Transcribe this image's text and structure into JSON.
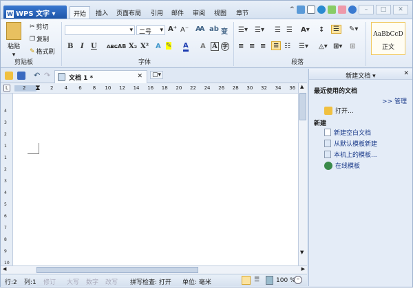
{
  "app": {
    "name": "WPS 文字"
  },
  "tabs": [
    "开始",
    "插入",
    "页面布局",
    "引用",
    "邮件",
    "审阅",
    "视图",
    "章节"
  ],
  "ribbon": {
    "clipboard": {
      "paste": "粘贴",
      "cut": "剪切",
      "copy": "复制",
      "format_painter": "格式刷",
      "label": "剪贴板"
    },
    "font": {
      "font_name": "",
      "font_size": "二号",
      "label": "字体",
      "bold": "B",
      "italic": "I",
      "underline": "U",
      "strike": "ABC",
      "double_strike": "AB",
      "subscript": "X₂",
      "superscript": "X²"
    },
    "paragraph": {
      "label": "段落"
    },
    "styles": {
      "preview": "AaBbCcD",
      "name": "正文"
    }
  },
  "document": {
    "tab_title": "文档 1 *"
  },
  "ruler": {
    "ticks": [
      "2",
      "2",
      "4",
      "6",
      "8",
      "10",
      "12",
      "14",
      "16",
      "18",
      "20",
      "22",
      "24",
      "26",
      "28",
      "30",
      "32",
      "34",
      "36"
    ],
    "vticks": [
      "4",
      "3",
      "2",
      "1",
      "1",
      "2",
      "3",
      "4",
      "5",
      "6",
      "7",
      "8",
      "9",
      "10"
    ]
  },
  "status": {
    "row": "行:2",
    "col": "列:1",
    "revise": "修订",
    "caps": "大写",
    "num": "数字",
    "overwrite": "改写",
    "spell": "拼写检查: 打开",
    "unit": "单位: 毫米",
    "zoom": "100 %"
  },
  "pane": {
    "title": "新建文档",
    "recent_heading": "最近使用的文档",
    "manage": ">> 管理",
    "open": "打开...",
    "new_heading": "新建",
    "items": [
      "新建空白文档",
      "从默认模板新建",
      "本机上的模板...",
      "在线模板"
    ]
  }
}
